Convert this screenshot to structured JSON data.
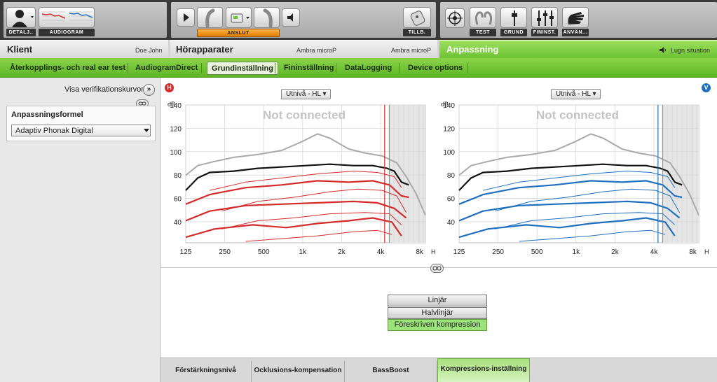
{
  "toolbar": {
    "detail_label": "DETALJ..",
    "audiogram_label": "AUDIOGRAM",
    "connect_label": "ANSLUT",
    "accessories_label": "TILLB.",
    "test_label": "TEST",
    "basic_label": "GRUND",
    "fine_label": "FININST.",
    "user_label": "ANVÄN..."
  },
  "sections": {
    "client_title": "Klient",
    "client_name": "Doe John",
    "hearing_aids_title": "Hörapparater",
    "hearing_aid_left": "Ambra microP",
    "hearing_aid_right": "Ambra microP",
    "fitting_title": "Anpassning",
    "situation_label": "Lugn situation"
  },
  "tabs": [
    {
      "label": "Återkopplings- och real ear test"
    },
    {
      "label": "AudiogramDirect"
    },
    {
      "label": "Grundinställning"
    },
    {
      "label": "Fininställning"
    },
    {
      "label": "DataLogging"
    },
    {
      "label": "Device options"
    }
  ],
  "left_panel": {
    "verification_label": "Visa verifikationskurvor",
    "formula_heading": "Anpassningsformel",
    "formula_value": "Adaptiv Phonak Digital"
  },
  "charts": {
    "right_ear_badge": "H",
    "left_ear_badge": "V",
    "level_dropdown": "Utnivå - HL",
    "status": "Not connected",
    "y_unit": "dB",
    "x_unit": "Hz",
    "y_ticks": [
      "140",
      "120",
      "100",
      "80",
      "60",
      "40"
    ],
    "x_ticks": [
      "125",
      "250",
      "500",
      "1k",
      "2k",
      "4k",
      "8k"
    ]
  },
  "compression_options": [
    {
      "label": "Linjär",
      "selected": false
    },
    {
      "label": "Halvlinjär",
      "selected": false
    },
    {
      "label": "Föreskriven kompression",
      "selected": true
    }
  ],
  "bottom_tabs": [
    {
      "label": "Förstärkningsnivå"
    },
    {
      "label": "Ocklusions-kompensation"
    },
    {
      "label": "BassBoost"
    },
    {
      "label": "Kompressions-inställning"
    }
  ],
  "colors": {
    "accent_green": "#6cc233",
    "right_ear": "#d42a2a",
    "left_ear": "#1f6fbf"
  }
}
